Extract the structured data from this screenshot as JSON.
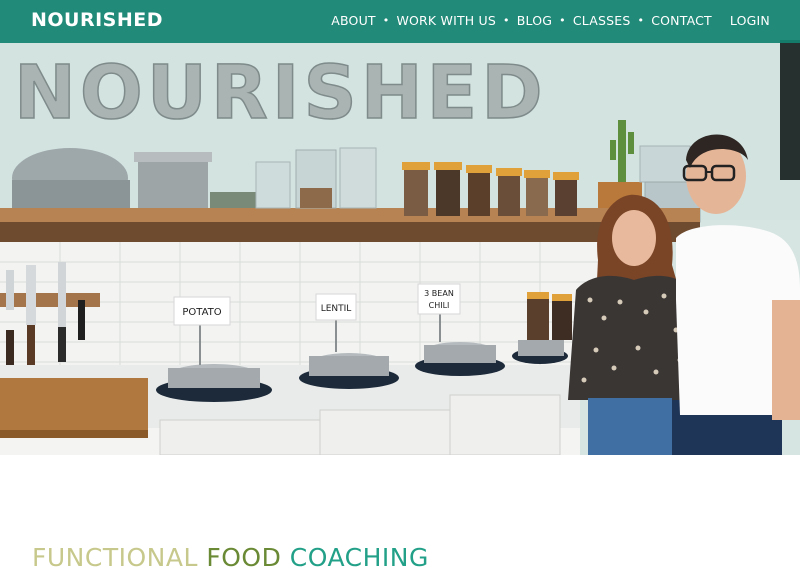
{
  "brand": {
    "logo_text": "NOURISHED"
  },
  "nav": {
    "items": [
      {
        "label": "ABOUT"
      },
      {
        "label": "WORK WITH US"
      },
      {
        "label": "BLOG"
      },
      {
        "label": "CLASSES"
      },
      {
        "label": "CONTACT"
      }
    ],
    "login_label": "LOGIN"
  },
  "hero": {
    "wall_letters": "NOURISHED",
    "signs": {
      "potato": "POTATO",
      "lentil": "LENTIL",
      "chili_line1": "3 BEAN",
      "chili_line2": "CHILI"
    }
  },
  "tagline": {
    "part1": "FUNCTIONAL",
    "part2": "FOOD",
    "part3": "COACHING"
  },
  "colors": {
    "nav_bg": "#128270",
    "tag_part1": "#c7c98c",
    "tag_part2": "#6a8a35",
    "tag_part3": "#23a088"
  }
}
